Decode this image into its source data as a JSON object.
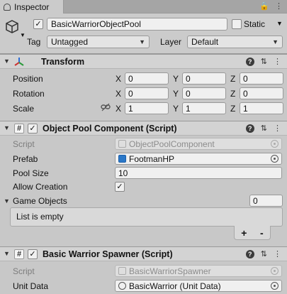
{
  "window": {
    "tab_title": "Inspector",
    "tab_icons": [
      "lock-icon",
      "menu-icon"
    ]
  },
  "header": {
    "object_name": "BasicWarriorObjectPool",
    "active": true,
    "static_label": "Static",
    "static_checked": false,
    "tag_label": "Tag",
    "tag_value": "Untagged",
    "layer_label": "Layer",
    "layer_value": "Default"
  },
  "transform": {
    "title": "Transform",
    "rows": [
      {
        "label": "Position",
        "x": "0",
        "y": "0",
        "z": "0"
      },
      {
        "label": "Rotation",
        "x": "0",
        "y": "0",
        "z": "0"
      },
      {
        "label": "Scale",
        "x": "1",
        "y": "1",
        "z": "1"
      }
    ],
    "axis_labels": {
      "x": "X",
      "y": "Y",
      "z": "Z"
    }
  },
  "object_pool": {
    "title": "Object Pool Component (Script)",
    "enabled": true,
    "script_label": "Script",
    "script_value": "ObjectPoolComponent",
    "prefab_label": "Prefab",
    "prefab_value": "FootmanHP",
    "pool_size_label": "Pool Size",
    "pool_size_value": "10",
    "allow_creation_label": "Allow Creation",
    "allow_creation_checked": true,
    "game_objects_label": "Game Objects",
    "game_objects_count": "0",
    "list_empty_text": "List is empty",
    "add_label": "+",
    "remove_label": "-"
  },
  "spawner": {
    "title": "Basic Warrior Spawner (Script)",
    "enabled": true,
    "script_label": "Script",
    "script_value": "BasicWarriorSpawner",
    "unit_data_label": "Unit Data",
    "unit_data_value": "BasicWarrior (Unit Data)"
  },
  "colors": {
    "panel_bg": "#c8c8c8",
    "header_bg": "#d3d3d3",
    "field_bg": "#f0f0f0",
    "prefab_icon": "#2b78c8"
  }
}
